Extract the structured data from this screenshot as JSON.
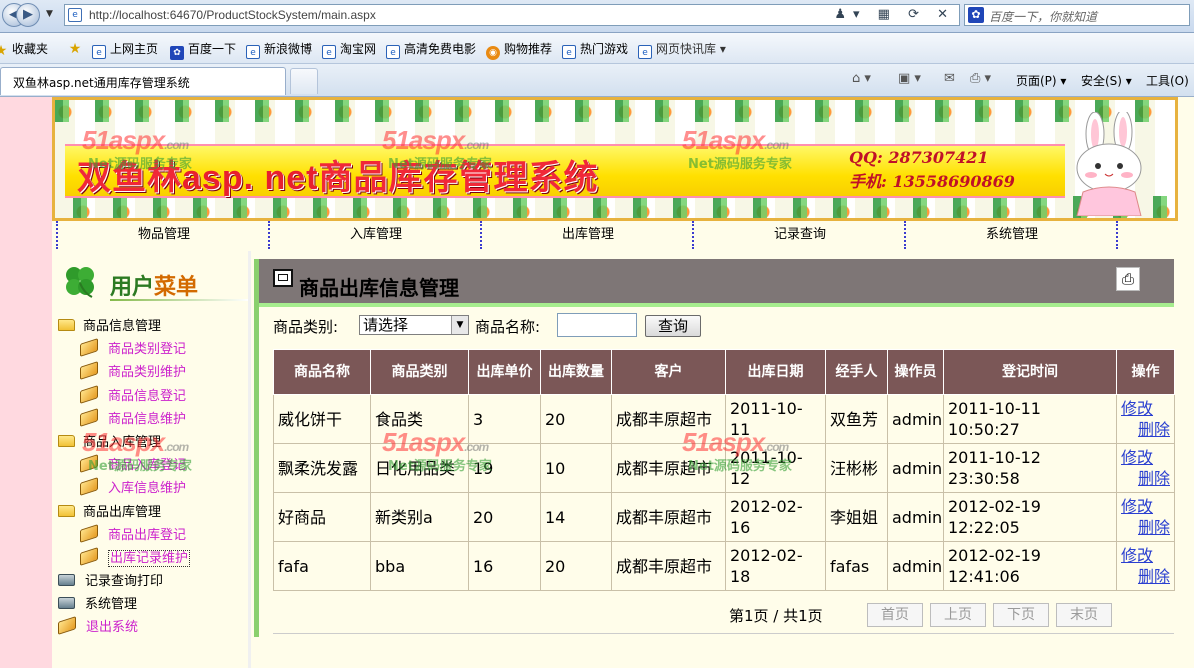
{
  "browser": {
    "url": "http://localhost:64670/ProductStockSystem/main.aspx",
    "search_placeholder": "百度一下，你就知道",
    "favorites_label": "收藏夹",
    "favorites": [
      "上网主页",
      "百度一下",
      "新浪微博",
      "淘宝网",
      "高清免费电影",
      "购物推荐",
      "热门游戏",
      "网页快讯库"
    ],
    "tab_title": "双鱼林asp.net通用库存管理系统",
    "commands": [
      "页面(P)",
      "安全(S)",
      "工具(O)"
    ]
  },
  "banner": {
    "title_left": "双鱼林",
    "title_en": "asp. net",
    "title_right": "商品库存管理系统",
    "qq": "QQ: 287307421",
    "phone": "手机: 13558690869"
  },
  "watermark": {
    "brand": "51aspx",
    "suffix": ".com",
    "tagline": "Net源码服务专家"
  },
  "nav": [
    "物品管理",
    "入库管理",
    "出库管理",
    "记录查询",
    "系统管理"
  ],
  "sidebar": {
    "title_a": "用户",
    "title_b": "菜单",
    "groups": [
      {
        "label": "商品信息管理",
        "items": [
          "商品类别登记",
          "商品类别维护",
          "商品信息登记",
          "商品信息维护"
        ]
      },
      {
        "label": "商品入库管理",
        "items": [
          "商品入库登记",
          "入库信息维护"
        ]
      },
      {
        "label": "商品出库管理",
        "items": [
          "商品出库登记",
          "出库记录维护"
        ]
      }
    ],
    "extra": [
      "记录查询打印",
      "系统管理",
      "退出系统"
    ]
  },
  "main": {
    "title": "商品出库信息管理",
    "search": {
      "category_label": "商品类别:",
      "category_value": "请选择",
      "name_label": "商品名称:",
      "name_value": "",
      "button": "查询"
    },
    "columns": [
      "商品名称",
      "商品类别",
      "出库单价",
      "出库数量",
      "客户",
      "出库日期",
      "经手人",
      "操作员",
      "登记时间",
      "操作"
    ],
    "rows": [
      {
        "name": "威化饼干",
        "category": "食品类",
        "price": "3",
        "qty": "20",
        "customer": "成都丰原超市",
        "date": "2011-10-11",
        "handler": "双鱼芳",
        "operator": "admin",
        "time": "2011-10-11 10:50:27"
      },
      {
        "name": "飘柔洗发露",
        "category": "日化用品类",
        "price": "19",
        "qty": "10",
        "customer": "成都丰原超市",
        "date": "2011-10-12",
        "handler": "汪彬彬",
        "operator": "admin",
        "time": "2011-10-12 23:30:58"
      },
      {
        "name": "好商品",
        "category": "新类别a",
        "price": "20",
        "qty": "14",
        "customer": "成都丰原超市",
        "date": "2012-02-16",
        "handler": "李姐姐",
        "operator": "admin",
        "time": "2012-02-19 12:22:05"
      },
      {
        "name": "fafa",
        "category": "bba",
        "price": "16",
        "qty": "20",
        "customer": "成都丰原超市",
        "date": "2012-02-18",
        "handler": "fafas",
        "operator": "admin",
        "time": "2012-02-19 12:41:06"
      }
    ],
    "row_actions": {
      "edit": "修改",
      "delete": "删除"
    },
    "pager": {
      "info": "第1页 / 共1页",
      "first": "首页",
      "prev": "上页",
      "next": "下页",
      "last": "末页"
    }
  }
}
